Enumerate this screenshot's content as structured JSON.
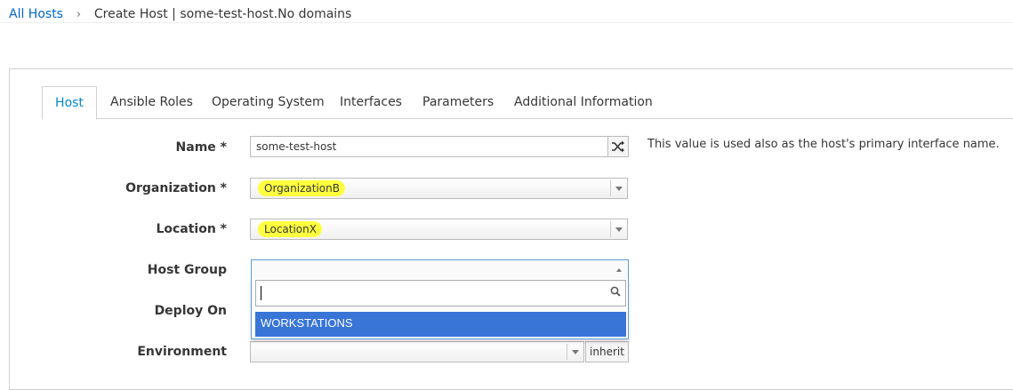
{
  "breadcrumb": {
    "root": "All Hosts",
    "separator": "›",
    "current": "Create Host | some-test-host.No domains"
  },
  "tabs": [
    "Host",
    "Ansible Roles",
    "Operating System",
    "Interfaces",
    "Parameters",
    "Additional Information"
  ],
  "active_tab": "Host",
  "form": {
    "name": {
      "label": "Name *",
      "value": "some-test-host",
      "help": "This value is used also as the host's primary interface name."
    },
    "organization": {
      "label": "Organization *",
      "value": "OrganizationB"
    },
    "location": {
      "label": "Location *",
      "value": "LocationX"
    },
    "host_group": {
      "label": "Host Group",
      "value": "",
      "search_value": "",
      "options": [
        "WORKSTATIONS"
      ]
    },
    "deploy_on": {
      "label": "Deploy On"
    },
    "environment": {
      "label": "Environment",
      "value": "",
      "inherit_label": "inherit"
    }
  },
  "colors": {
    "link": "#0066cc",
    "active_tab": "#0088ce",
    "highlight": "#ffff40",
    "selected_option": "#3875d7",
    "focus_border": "#5b9dd9"
  },
  "icons": [
    "shuffle-icon",
    "search-icon",
    "chevron-down-icon",
    "chevron-up-icon"
  ]
}
